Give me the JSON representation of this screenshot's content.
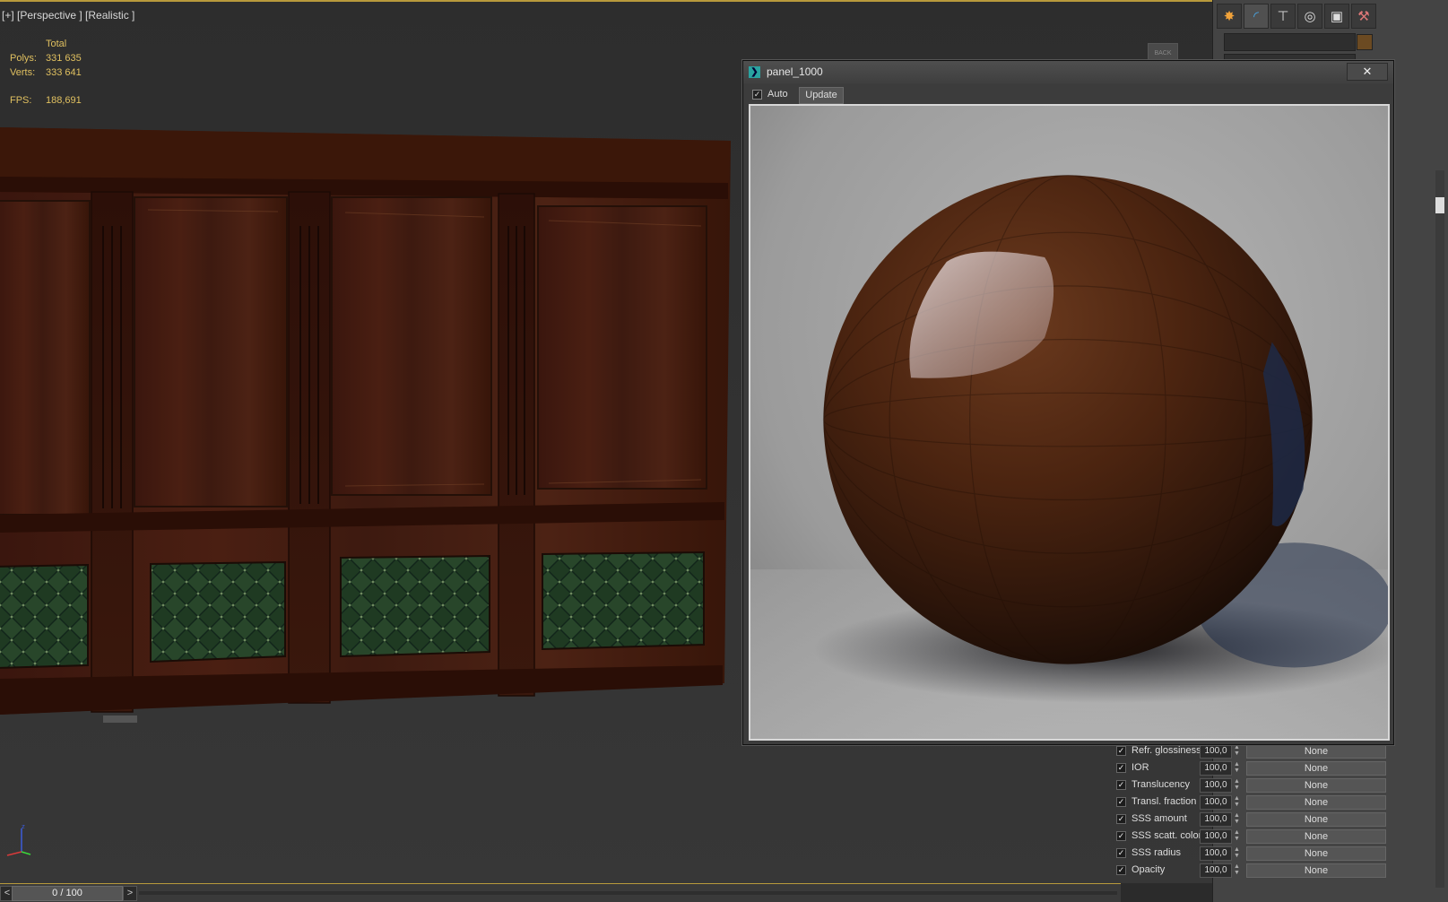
{
  "viewport": {
    "label": "[+] [Perspective ] [Realistic ]",
    "stats": {
      "header": "Total",
      "polys_label": "Polys:",
      "polys_value": "331 635",
      "verts_label": "Verts:",
      "verts_value": "333 641",
      "fps_label": "FPS:",
      "fps_value": "188,691"
    },
    "viewcube_text": "BACK"
  },
  "timeline": {
    "prev": "<",
    "frame": "0 / 100",
    "next": ">"
  },
  "command_panel": {
    "tabs": [
      "create-icon",
      "modify-icon",
      "hierarchy-icon",
      "motion-icon",
      "display-icon",
      "utilities-icon"
    ],
    "swatch_color": "#6b4a22",
    "maps": [
      {
        "label": "Refr. glossiness",
        "value": "100,0",
        "map": "None",
        "checked": true
      },
      {
        "label": "IOR",
        "value": "100,0",
        "map": "None",
        "checked": true
      },
      {
        "label": "Translucency",
        "value": "100,0",
        "map": "None",
        "checked": true
      },
      {
        "label": "Transl. fraction",
        "value": "100,0",
        "map": "None",
        "checked": true
      },
      {
        "label": "SSS amount",
        "value": "100,0",
        "map": "None",
        "checked": true
      },
      {
        "label": "SSS scatt. color",
        "value": "100,0",
        "map": "None",
        "checked": true
      },
      {
        "label": "SSS radius",
        "value": "100,0",
        "map": "None",
        "checked": true
      },
      {
        "label": "Opacity",
        "value": "100,0",
        "map": "None",
        "checked": true
      }
    ]
  },
  "preview_window": {
    "title": "panel_1000",
    "close": "✕",
    "auto_label": "Auto",
    "auto_checked": true,
    "update_label": "Update"
  }
}
